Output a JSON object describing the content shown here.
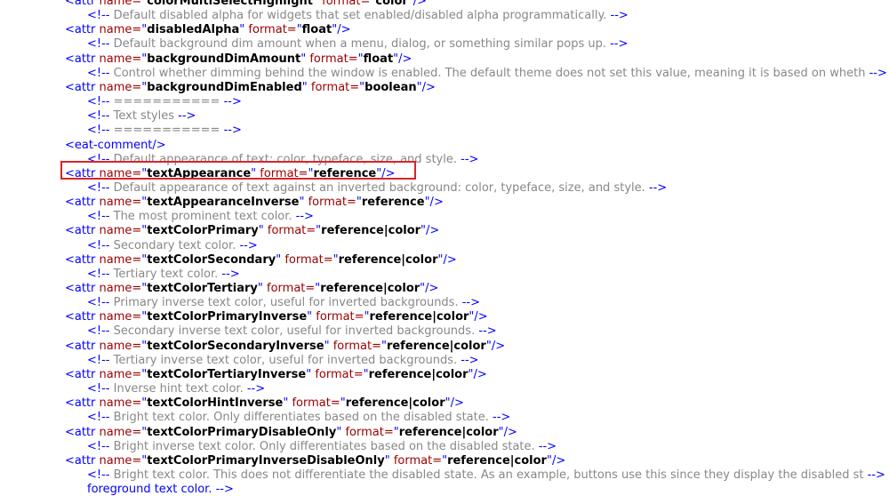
{
  "lines": [
    {
      "kind": "tag",
      "name": "colorMultiSelectHighlight",
      "format": "color"
    },
    {
      "kind": "comment",
      "text": "Default disabled alpha for widgets that set enabled/disabled alpha programmatically."
    },
    {
      "kind": "tag",
      "name": "disabledAlpha",
      "format": "float"
    },
    {
      "kind": "comment",
      "text": "Default background dim amount when a menu, dialog, or something similar pops up."
    },
    {
      "kind": "tag",
      "name": "backgroundDimAmount",
      "format": "float"
    },
    {
      "kind": "comment",
      "text": "Control whether dimming behind the window is enabled. The default theme does not set this value, meaning it is based on wheth"
    },
    {
      "kind": "tag",
      "name": "backgroundDimEnabled",
      "format": "boolean"
    },
    {
      "kind": "comment",
      "text": "==========="
    },
    {
      "kind": "comment",
      "text": "Text styles"
    },
    {
      "kind": "comment",
      "text": "==========="
    },
    {
      "kind": "eat",
      "text": "<eat-comment/>"
    },
    {
      "kind": "comment",
      "text": "Default appearance of text: color, typeface, size, and style."
    },
    {
      "kind": "tag",
      "name": "textAppearance",
      "format": "reference",
      "highlighted": true
    },
    {
      "kind": "comment",
      "text": "Default appearance of text against an inverted background: color, typeface, size, and style."
    },
    {
      "kind": "tag",
      "name": "textAppearanceInverse",
      "format": "reference"
    },
    {
      "kind": "comment",
      "text": "The most prominent text color."
    },
    {
      "kind": "tag",
      "name": "textColorPrimary",
      "format": "reference|color"
    },
    {
      "kind": "comment",
      "text": "Secondary text color."
    },
    {
      "kind": "tag",
      "name": "textColorSecondary",
      "format": "reference|color"
    },
    {
      "kind": "comment",
      "text": "Tertiary text color."
    },
    {
      "kind": "tag",
      "name": "textColorTertiary",
      "format": "reference|color"
    },
    {
      "kind": "comment",
      "text": "Primary inverse text color, useful for inverted backgrounds."
    },
    {
      "kind": "tag",
      "name": "textColorPrimaryInverse",
      "format": "reference|color"
    },
    {
      "kind": "comment",
      "text": "Secondary inverse text color, useful for inverted backgrounds."
    },
    {
      "kind": "tag",
      "name": "textColorSecondaryInverse",
      "format": "reference|color"
    },
    {
      "kind": "comment",
      "text": "Tertiary inverse text color, useful for inverted backgrounds."
    },
    {
      "kind": "tag",
      "name": "textColorTertiaryInverse",
      "format": "reference|color"
    },
    {
      "kind": "comment",
      "text": "Inverse hint text color."
    },
    {
      "kind": "tag",
      "name": "textColorHintInverse",
      "format": "reference|color"
    },
    {
      "kind": "comment",
      "text": "Bright text color. Only differentiates based on the disabled state."
    },
    {
      "kind": "tag",
      "name": "textColorPrimaryDisableOnly",
      "format": "reference|color"
    },
    {
      "kind": "comment",
      "text": "Bright inverse text color. Only differentiates based on the disabled state."
    },
    {
      "kind": "tag",
      "name": "textColorPrimaryInverseDisableOnly",
      "format": "reference|color"
    },
    {
      "kind": "comment",
      "text": "Bright text color. This does not differentiate the disabled state. As an example, buttons use this since they display the disabled st"
    },
    {
      "kind": "plain",
      "text": "foreground text color. -->"
    }
  ],
  "syntax": {
    "attr_open": "<attr ",
    "name_attr": "name=",
    "format_attr": " format=",
    "self_close": "/>",
    "comment_open": "<!-- ",
    "comment_close": " -->",
    "quote": "\""
  },
  "colors": {
    "tag": "#0000ff",
    "attribute_name": "#990000",
    "attribute_value": "#000000",
    "comment": "#888888",
    "highlight_border": "#d9242b"
  }
}
